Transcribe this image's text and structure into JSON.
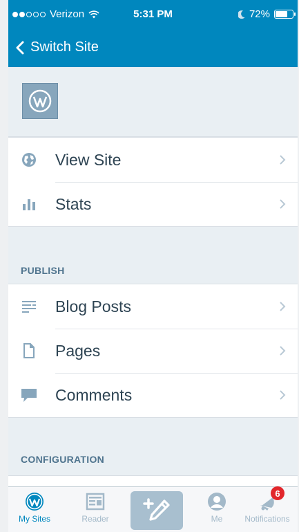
{
  "status_bar": {
    "signal_dots_filled": 2,
    "signal_dots_total": 5,
    "carrier": "Verizon",
    "time": "5:31 PM",
    "battery_text": "72%",
    "battery_level": 0.72
  },
  "nav": {
    "back_label": "Switch Site"
  },
  "site": {
    "icon": "wordpress-logo-icon"
  },
  "menu": {
    "main": [
      {
        "label": "View Site",
        "icon": "globe-icon"
      },
      {
        "label": "Stats",
        "icon": "stats-bars-icon"
      }
    ],
    "publish_header": "PUBLISH",
    "publish": [
      {
        "label": "Blog Posts",
        "icon": "posts-icon"
      },
      {
        "label": "Pages",
        "icon": "page-icon"
      },
      {
        "label": "Comments",
        "icon": "comment-icon"
      }
    ],
    "configuration_header": "CONFIGURATION"
  },
  "tabbar": {
    "my_sites": "My Sites",
    "reader": "Reader",
    "me": "Me",
    "notifications": "Notifications",
    "notifications_badge": "6",
    "active_tab": "my_sites"
  },
  "colors": {
    "brand_blue": "#0087be",
    "background": "#e9eff3",
    "text_primary": "#2e4453",
    "section_header": "#4f748e",
    "icon_gray": "#87a6bc",
    "badge_red": "#e2262b"
  }
}
